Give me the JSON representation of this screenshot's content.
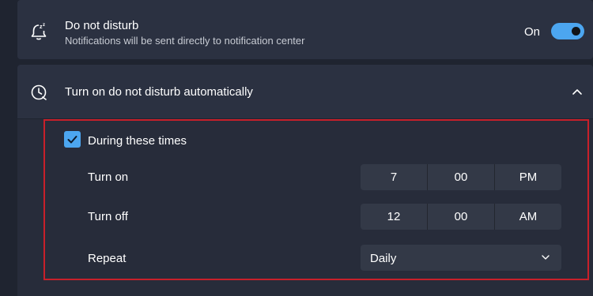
{
  "dnd": {
    "title": "Do not disturb",
    "subtitle": "Notifications will be sent directly to notification center",
    "toggle_label": "On",
    "toggle_on": true,
    "icon": "bell-snooze-icon"
  },
  "auto": {
    "title": "Turn on do not disturb automatically",
    "icon": "clock-icon",
    "expanded": true
  },
  "schedule": {
    "checkbox_label": "During these times",
    "checked": true,
    "turn_on": {
      "label": "Turn on",
      "hour": "7",
      "minute": "00",
      "period": "PM"
    },
    "turn_off": {
      "label": "Turn off",
      "hour": "12",
      "minute": "00",
      "period": "AM"
    },
    "repeat": {
      "label": "Repeat",
      "value": "Daily"
    }
  },
  "colors": {
    "accent": "#4ca6f0",
    "highlight": "#c8202a",
    "background": "#1f2430",
    "card": "#2b3141"
  }
}
